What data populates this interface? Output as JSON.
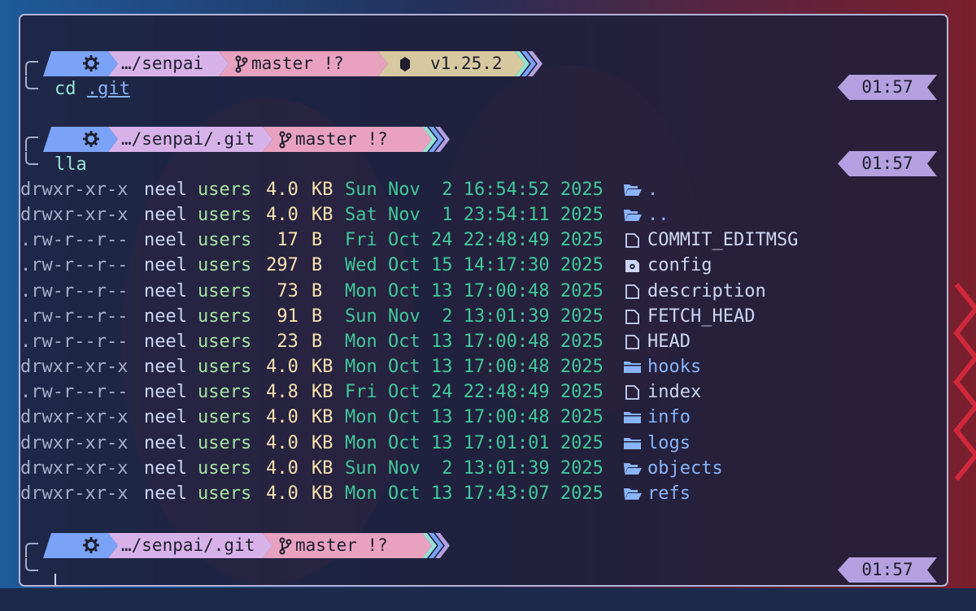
{
  "colors": {
    "seg_os": "#7aa2f7",
    "seg_path": "#d7b2e8",
    "seg_branch": "#e8a2c0",
    "seg_node": "#d8c8a0",
    "time_bg": "#b4a0e0",
    "dir_name": "#89b4fa",
    "date": "#40c89a",
    "size": "#f9e2af"
  },
  "prompts": [
    {
      "path": "…/senpai",
      "branch": "master !?",
      "node_icon": "nodejs-icon",
      "node_version": "v1.25.2",
      "command": "cd ",
      "command_arg": ".git",
      "time": "01:57"
    },
    {
      "path": "…/senpai/.git",
      "branch": "master !?",
      "command": "lla",
      "time": "01:57"
    },
    {
      "path": "…/senpai/.git",
      "branch": "master !?",
      "command": "",
      "time": "01:57"
    }
  ],
  "listing": [
    {
      "perms": "drwxr-xr-x",
      "user": "neel",
      "group": "users",
      "size": "4.0",
      "unit": "KB",
      "date": "Sun Nov  2 16:54:52 2025",
      "icon": "folder-open-icon",
      "name": ".",
      "type": "dir"
    },
    {
      "perms": "drwxr-xr-x",
      "user": "neel",
      "group": "users",
      "size": "4.0",
      "unit": "KB",
      "date": "Sat Nov  1 23:54:11 2025",
      "icon": "folder-open-icon",
      "name": "..",
      "type": "dir"
    },
    {
      "perms": ".rw-r--r--",
      "user": "neel",
      "group": "users",
      "size": "17",
      "unit": "B",
      "date": "Fri Oct 24 22:48:49 2025",
      "icon": "file-icon",
      "name": "COMMIT_EDITMSG",
      "type": "file"
    },
    {
      "perms": ".rw-r--r--",
      "user": "neel",
      "group": "users",
      "size": "297",
      "unit": "B",
      "date": "Wed Oct 15 14:17:30 2025",
      "icon": "config-file-icon",
      "name": "config",
      "type": "file"
    },
    {
      "perms": ".rw-r--r--",
      "user": "neel",
      "group": "users",
      "size": "73",
      "unit": "B",
      "date": "Mon Oct 13 17:00:48 2025",
      "icon": "file-icon",
      "name": "description",
      "type": "file"
    },
    {
      "perms": ".rw-r--r--",
      "user": "neel",
      "group": "users",
      "size": "91",
      "unit": "B",
      "date": "Sun Nov  2 13:01:39 2025",
      "icon": "file-icon",
      "name": "FETCH_HEAD",
      "type": "file"
    },
    {
      "perms": ".rw-r--r--",
      "user": "neel",
      "group": "users",
      "size": "23",
      "unit": "B",
      "date": "Mon Oct 13 17:00:48 2025",
      "icon": "file-icon",
      "name": "HEAD",
      "type": "file"
    },
    {
      "perms": "drwxr-xr-x",
      "user": "neel",
      "group": "users",
      "size": "4.0",
      "unit": "KB",
      "date": "Mon Oct 13 17:00:48 2025",
      "icon": "folder-icon",
      "name": "hooks",
      "type": "dir"
    },
    {
      "perms": ".rw-r--r--",
      "user": "neel",
      "group": "users",
      "size": "4.8",
      "unit": "KB",
      "date": "Fri Oct 24 22:48:49 2025",
      "icon": "file-icon",
      "name": "index",
      "type": "file"
    },
    {
      "perms": "drwxr-xr-x",
      "user": "neel",
      "group": "users",
      "size": "4.0",
      "unit": "KB",
      "date": "Mon Oct 13 17:00:48 2025",
      "icon": "folder-icon",
      "name": "info",
      "type": "dir"
    },
    {
      "perms": "drwxr-xr-x",
      "user": "neel",
      "group": "users",
      "size": "4.0",
      "unit": "KB",
      "date": "Mon Oct 13 17:01:01 2025",
      "icon": "folder-icon",
      "name": "logs",
      "type": "dir"
    },
    {
      "perms": "drwxr-xr-x",
      "user": "neel",
      "group": "users",
      "size": "4.0",
      "unit": "KB",
      "date": "Sun Nov  2 13:01:39 2025",
      "icon": "folder-open-icon",
      "name": "objects",
      "type": "dir"
    },
    {
      "perms": "drwxr-xr-x",
      "user": "neel",
      "group": "users",
      "size": "4.0",
      "unit": "KB",
      "date": "Mon Oct 13 17:43:07 2025",
      "icon": "folder-open-icon",
      "name": "refs",
      "type": "dir"
    }
  ]
}
